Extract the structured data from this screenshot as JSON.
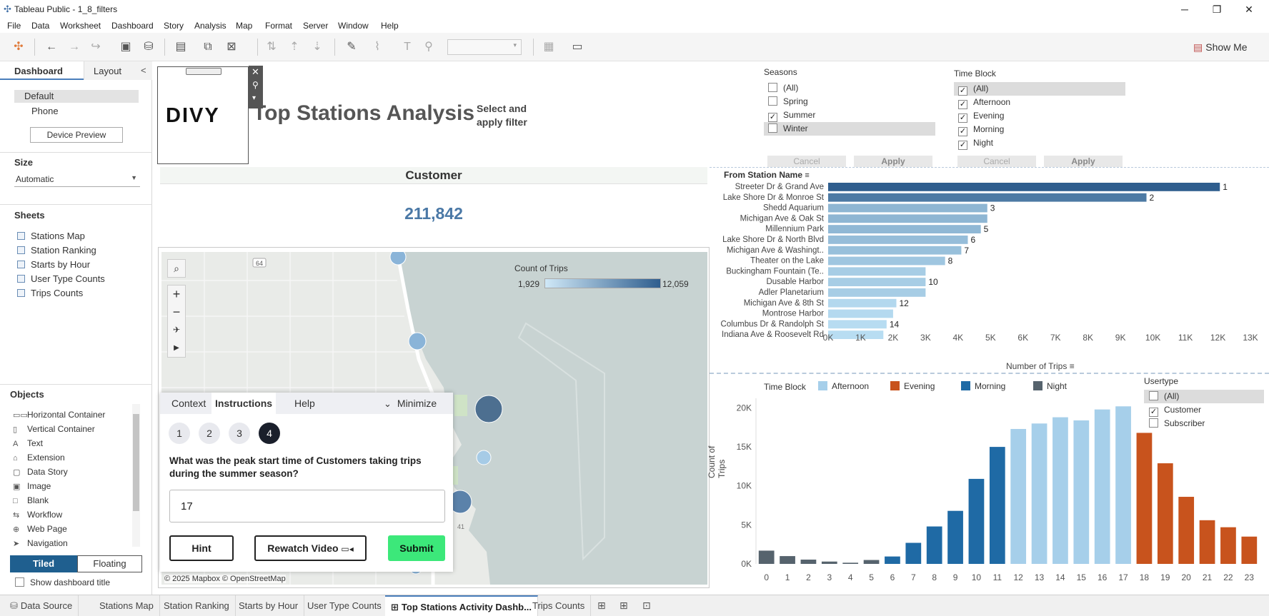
{
  "window": {
    "title": "Tableau Public - 1_8_filters",
    "minimize": "─",
    "restore": "❐",
    "close": "✕"
  },
  "menu": [
    "File",
    "Data",
    "Worksheet",
    "Dashboard",
    "Story",
    "Analysis",
    "Map",
    "Format",
    "Server",
    "Window",
    "Help"
  ],
  "toolbar": {
    "show_me": "Show Me"
  },
  "left_panel": {
    "tab_dashboard": "Dashboard",
    "tab_layout": "Layout",
    "collapse": "<",
    "device_default": "Default",
    "device_phone": "Phone",
    "device_preview": "Device Preview",
    "size_title": "Size",
    "size_value": "Automatic",
    "sheets_title": "Sheets",
    "sheets": [
      "Stations Map",
      "Station Ranking",
      "Starts by Hour",
      "User Type Counts",
      "Trips Counts"
    ],
    "objects_title": "Objects",
    "objects": [
      {
        "icon": "▭▭",
        "label": "Horizontal Container"
      },
      {
        "icon": "▯",
        "label": "Vertical Container"
      },
      {
        "icon": "A",
        "label": "Text"
      },
      {
        "icon": "⌂",
        "label": "Extension"
      },
      {
        "icon": "▢",
        "label": "Data Story"
      },
      {
        "icon": "▣",
        "label": "Image"
      },
      {
        "icon": "□",
        "label": "Blank"
      },
      {
        "icon": "⇆",
        "label": "Workflow"
      },
      {
        "icon": "⊕",
        "label": "Web Page"
      },
      {
        "icon": "➤",
        "label": "Navigation"
      }
    ],
    "tiled": "Tiled",
    "floating": "Floating",
    "show_title": "Show dashboard title"
  },
  "dashboard": {
    "logo_text": "DIVY",
    "title": "Top Stations Analysis",
    "instruction": "Select and apply filter",
    "customer_label": "Customer",
    "customer_value": "211,842",
    "map_legend_title": "Count of Trips",
    "map_legend_min": "1,929",
    "map_legend_max": "12,059",
    "map_credit": "© 2025 Mapbox © OpenStreetMap",
    "map_road": "64",
    "map_road2": "41"
  },
  "seasons_filter": {
    "title": "Seasons",
    "items": [
      {
        "label": "(All)",
        "checked": false
      },
      {
        "label": "Spring",
        "checked": false
      },
      {
        "label": "Summer",
        "checked": true
      },
      {
        "label": "Winter",
        "checked": false
      }
    ],
    "cancel": "Cancel",
    "apply": "Apply"
  },
  "timeblock_filter": {
    "title": "Time Block",
    "items": [
      {
        "label": "(All)",
        "checked": true
      },
      {
        "label": "Afternoon",
        "checked": true
      },
      {
        "label": "Evening",
        "checked": true
      },
      {
        "label": "Morning",
        "checked": true
      },
      {
        "label": "Night",
        "checked": true
      }
    ],
    "cancel": "Cancel",
    "apply": "Apply"
  },
  "usertype_filter": {
    "title": "Usertype",
    "items": [
      {
        "label": "(All)",
        "checked": false
      },
      {
        "label": "Customer",
        "checked": true
      },
      {
        "label": "Subscriber",
        "checked": false
      }
    ]
  },
  "ranking_chart": {
    "header": "From Station Name",
    "xlabel": "Number of Trips",
    "ticks": [
      "0K",
      "1K",
      "2K",
      "3K",
      "4K",
      "5K",
      "6K",
      "7K",
      "8K",
      "9K",
      "10K",
      "11K",
      "12K",
      "13K"
    ]
  },
  "hour_chart": {
    "ylabel": "Count of Trips",
    "legend_title": "Time Block",
    "legend": [
      {
        "name": "Afternoon",
        "color": "#a6cfea"
      },
      {
        "name": "Evening",
        "color": "#c8531d"
      },
      {
        "name": "Morning",
        "color": "#1f6aa5"
      },
      {
        "name": "Night",
        "color": "#56636d"
      }
    ],
    "yticks": [
      "20K",
      "15K",
      "10K",
      "5K",
      "0K"
    ]
  },
  "modal": {
    "tabs": [
      "Context",
      "Instructions",
      "Help"
    ],
    "minimize": "Minimize",
    "steps": [
      "1",
      "2",
      "3",
      "4"
    ],
    "question": "What was the peak start time of Customers taking trips during the summer season?",
    "answer": "17",
    "hint": "Hint",
    "rewatch": "Rewatch Video",
    "submit": "Submit"
  },
  "bottom_tabs": [
    "Data Source",
    "Stations Map",
    "Station Ranking",
    "Starts by Hour",
    "User Type Counts",
    "Top Stations Activity Dashb...",
    "Trips Counts"
  ],
  "chart_data": [
    {
      "type": "bar",
      "orientation": "horizontal",
      "categories": [
        "Streeter Dr & Grand Ave",
        "Lake Shore Dr & Monroe St",
        "Shedd Aquarium",
        "Michigan Ave & Oak St",
        "Millennium Park",
        "Lake Shore Dr & North Blvd",
        "Michigan Ave & Washingt..",
        "Theater on the Lake",
        "Buckingham Fountain (Te..",
        "Dusable Harbor",
        "Adler Planetarium",
        "Michigan Ave & 8th St",
        "Montrose Harbor",
        "Columbus Dr & Randolph St",
        "Indiana Ave & Roosevelt Rd"
      ],
      "values": [
        12059,
        9800,
        4900,
        4900,
        4700,
        4300,
        4100,
        3600,
        3000,
        3000,
        3000,
        2100,
        2000,
        1800,
        1700
      ],
      "data_labels": [
        "1",
        "2",
        "3",
        "",
        "5",
        "6",
        "7",
        "8",
        "",
        "10",
        "",
        "12",
        "",
        "14",
        ""
      ],
      "xlabel": "Number of Trips",
      "xlim": [
        0,
        13000
      ],
      "color_range": [
        "#b8ddf2",
        "#2f5e8e"
      ]
    },
    {
      "type": "bar",
      "categories": [
        "0",
        "1",
        "2",
        "3",
        "4",
        "5",
        "6",
        "7",
        "8",
        "9",
        "10",
        "11",
        "12",
        "13",
        "14",
        "15",
        "16",
        "17",
        "18",
        "19",
        "20",
        "21",
        "22",
        "23"
      ],
      "values": [
        1700,
        1000,
        550,
        300,
        150,
        500,
        950,
        2700,
        4800,
        6800,
        10900,
        15000,
        17300,
        18000,
        18800,
        18400,
        19800,
        20200,
        16800,
        12900,
        8600,
        5600,
        4700,
        3500
      ],
      "groups": [
        "Night",
        "Night",
        "Night",
        "Night",
        "Night",
        "Night",
        "Morning",
        "Morning",
        "Morning",
        "Morning",
        "Morning",
        "Morning",
        "Afternoon",
        "Afternoon",
        "Afternoon",
        "Afternoon",
        "Afternoon",
        "Afternoon",
        "Evening",
        "Evening",
        "Evening",
        "Evening",
        "Evening",
        "Evening"
      ],
      "ylabel": "Count of Trips",
      "ylim": [
        0,
        20500
      ]
    }
  ]
}
